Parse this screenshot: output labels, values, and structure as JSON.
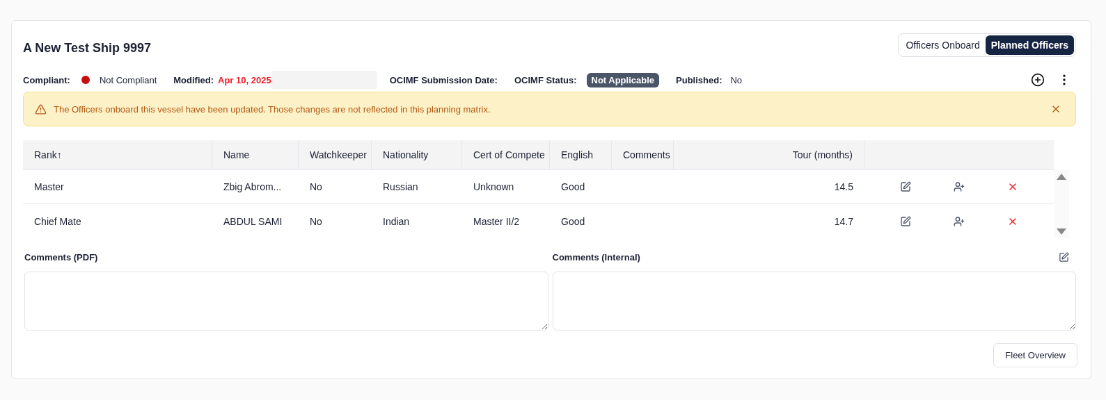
{
  "vessel": {
    "title": "A New Test Ship 9997"
  },
  "view_toggle": [
    {
      "label": "Officers Onboard",
      "selected": false
    },
    {
      "label": "Planned Officers",
      "selected": true
    }
  ],
  "info": {
    "compliant_label": "Compliant:",
    "compliant": false,
    "compliant_value": "Not Compliant",
    "modified_label": "Modified:",
    "modified_value": "Apr 10, 2025",
    "submission_label": "OCIMF Submission Date:",
    "status_label": "OCIMF Status:",
    "status_value": "Not Applicable",
    "published_label": "Published:",
    "published_value": "No"
  },
  "alert": {
    "text": "The Officers onboard this vessel have been updated. Those changes are not reflected in this planning matrix."
  },
  "table": {
    "columns": [
      "Rank↑",
      "Name",
      "Watchkeeper",
      "Nationality",
      "Cert of Compete",
      "English",
      "Comments",
      "Tour (months)"
    ],
    "rows": [
      {
        "cells": [
          "Master",
          "Zbig Abrom...",
          "No",
          "Russian",
          "Unknown",
          "Good",
          "",
          "14.5"
        ]
      },
      {
        "cells": [
          "Chief Mate",
          "ABDUL SAMI",
          "No",
          "Indian",
          "Master II/2",
          "Good",
          "",
          "14.7"
        ]
      }
    ]
  },
  "comments": [
    {
      "label": "Comments (PDF)",
      "editable": false
    },
    {
      "label": "Comments (Internal)",
      "editable": true
    }
  ],
  "footer": {
    "button": "Fleet Overview"
  }
}
